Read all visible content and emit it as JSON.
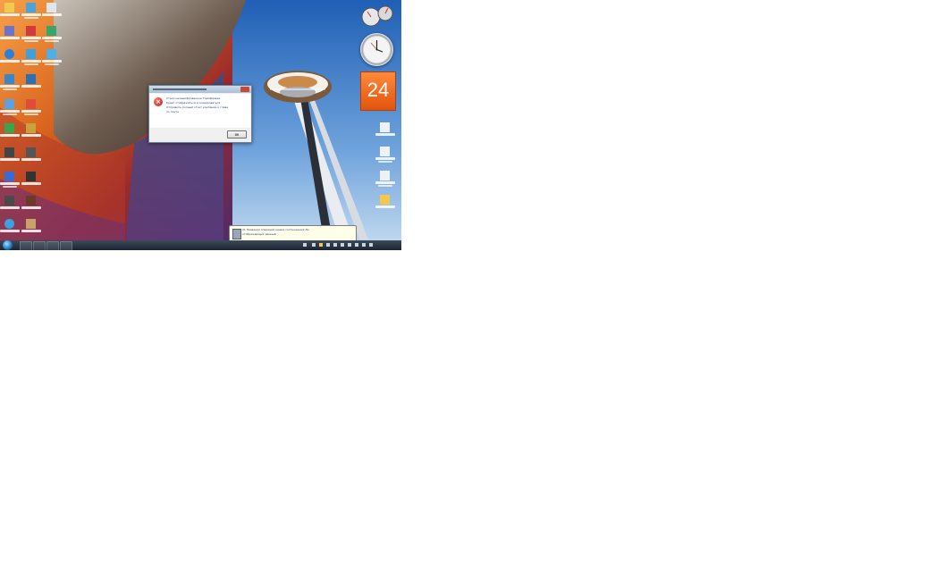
{
  "dialog": {
    "title": "",
    "message_lines": [
      "Стало незашифрованное Тимофеевка",
      "будет отображаться и сканироваться",
      "Отправить полный отчет компании к главе",
      "по почте"
    ],
    "ok_label": "ок"
  },
  "notification": {
    "line1": "21 Названия операций наших соотношения Ли",
    "line2": "отображающих данный"
  },
  "calendar_gadget": {
    "day": "24"
  },
  "colors": {
    "sky_top": "#1f5fb5",
    "sky_bottom": "#b9d6f2",
    "wall_orange": "#d9651e",
    "taskbar": "#1b2432",
    "calendar": "#e2540f",
    "error_red": "#c4170a"
  },
  "icons": {
    "error": "error-x-icon",
    "start": "windows-start-orb-icon",
    "clock": "analog-clock-gadget",
    "calendar": "calendar-gadget"
  }
}
